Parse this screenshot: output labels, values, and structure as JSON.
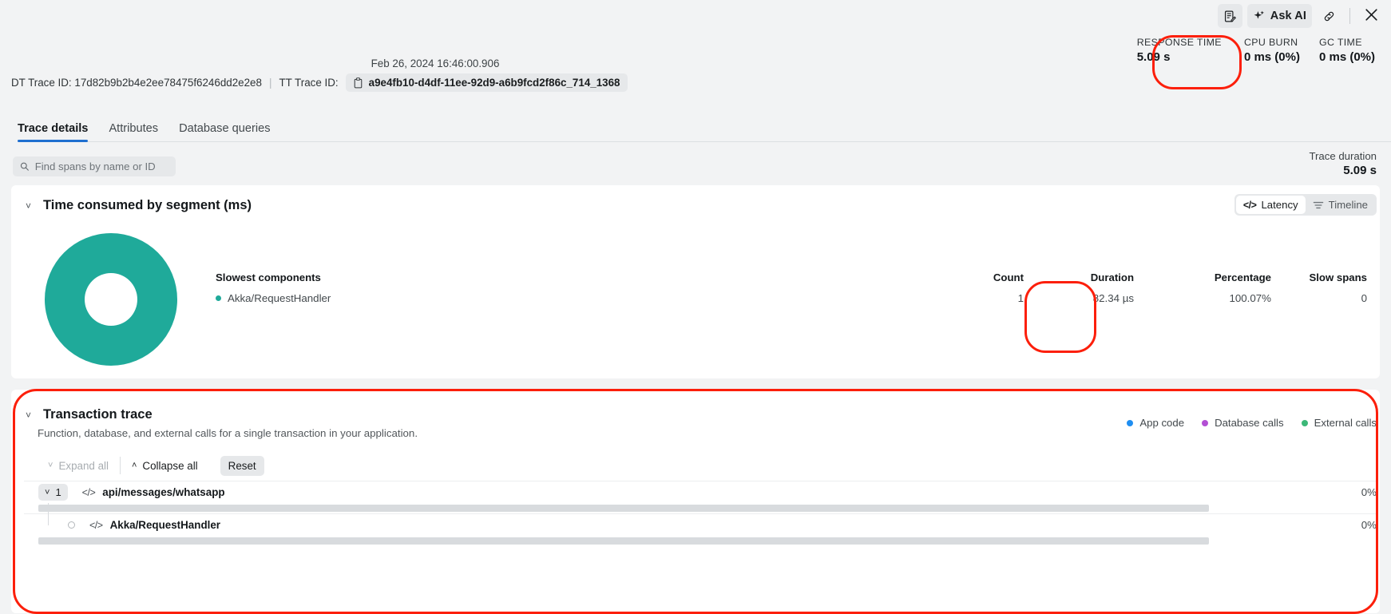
{
  "toolbar": {
    "note_icon": "note-edit-icon",
    "ask_ai_label": "Ask AI",
    "ask_ai_icon": "sparkle-icon",
    "link_icon": "link-icon",
    "close_icon": "close-icon"
  },
  "metrics": [
    {
      "label": "RESPONSE TIME",
      "value": "5.09 s",
      "highlighted": true
    },
    {
      "label": "CPU BURN",
      "value": "0 ms (0%)",
      "highlighted": false
    },
    {
      "label": "GC TIME",
      "value": "0 ms (0%)",
      "highlighted": false
    }
  ],
  "trace_header": {
    "timestamp": "Feb 26, 2024 16:46:00.906",
    "dt_trace_label": "DT Trace ID: 17d82b9b2b4e2ee78475f6246dd2e2e8",
    "separator": "|",
    "tt_trace_label": "TT Trace ID:",
    "tt_trace_id": "a9e4fb10-d4df-11ee-92d9-a6b9fcd2f86c_714_1368",
    "copy_icon": "clipboard-icon"
  },
  "tabs": [
    {
      "label": "Trace details",
      "active": true
    },
    {
      "label": "Attributes",
      "active": false
    },
    {
      "label": "Database queries",
      "active": false
    }
  ],
  "search": {
    "placeholder": "Find spans by name or ID",
    "value": "",
    "icon": "search-icon"
  },
  "trace_duration": {
    "label": "Trace duration",
    "value": "5.09 s"
  },
  "segment_section": {
    "title": "Time consumed by segment (ms)",
    "collapse_icon": "chevron-down-icon",
    "view_toggle": [
      {
        "label": "Latency",
        "icon": "code-icon",
        "active": true
      },
      {
        "label": "Timeline",
        "icon": "timeline-icon",
        "active": false
      }
    ],
    "columns": [
      "Slowest components",
      "Count",
      "Duration",
      "Percentage",
      "Slow spans"
    ],
    "rows": [
      {
        "component": "Akka/RequestHandler",
        "color": "#1faa9a",
        "count": "1",
        "duration": "82.34 µs",
        "percentage": "100.07%",
        "slow_spans": "0"
      }
    ]
  },
  "chart_data": {
    "type": "pie",
    "title": "Time consumed by segment (ms)",
    "labels": [
      "Akka/RequestHandler"
    ],
    "values": [
      100.07
    ],
    "colors": [
      "#1faa9a"
    ],
    "unit": "%",
    "donut": true,
    "inner_radius_ratio": 0.4,
    "legend_position": "right"
  },
  "transaction_trace": {
    "title": "Transaction trace",
    "subtitle": "Function, database, and external calls for a single transaction in your application.",
    "collapse_icon": "chevron-down-icon",
    "legend": [
      {
        "label": "App code",
        "color": "#1f8ef1"
      },
      {
        "label": "Database calls",
        "color": "#b34fd4"
      },
      {
        "label": "External calls",
        "color": "#3cb878"
      }
    ],
    "controls": [
      {
        "label": "Expand all",
        "icon": "chevron-down-icon",
        "disabled": true
      },
      {
        "label": "Collapse all",
        "icon": "chevron-up-icon",
        "disabled": false
      },
      {
        "label": "Reset",
        "icon": "",
        "disabled": false
      }
    ],
    "spans": [
      {
        "count": "1",
        "count_icon": "chevron-down-icon",
        "type_icon": "code-icon",
        "name": "api/messages/whatsapp",
        "percent": "0%",
        "depth": 0,
        "bar_start_pct": 0,
        "bar_width_pct": 100
      },
      {
        "count": "",
        "count_icon": "",
        "type_icon": "code-icon",
        "name": "Akka/RequestHandler",
        "percent": "0%",
        "depth": 1,
        "bar_start_pct": 0,
        "bar_width_pct": 100
      }
    ]
  },
  "annotations": {
    "color": "#fc1f0b",
    "regions": [
      "response-time-metric",
      "duration-column",
      "transaction-trace-card"
    ]
  }
}
